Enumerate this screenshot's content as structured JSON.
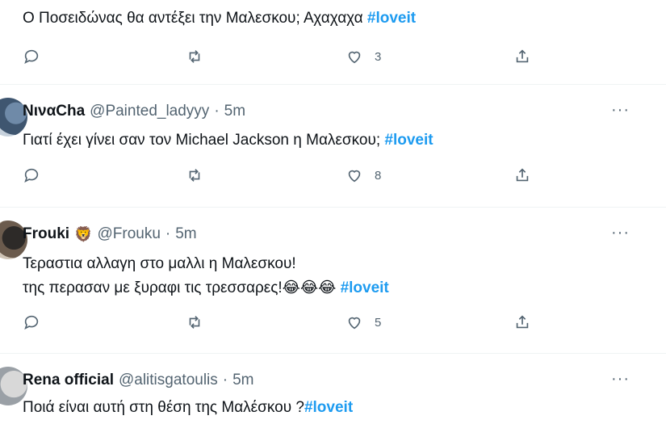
{
  "tweets": [
    {
      "text_pre": "Ο Ποσειδώνας θα αντέξει την Μαλεσκου; Αχαχαχα ",
      "hashtag": "#loveit",
      "likes": "3"
    },
    {
      "name": "ΝιναCha",
      "handle": "@Painted_ladyyy",
      "dot": "·",
      "time": "5m",
      "more": "···",
      "text_pre": "Γιατί έχει γίνει σαν τον Michael Jackson η Μαλεσκου; ",
      "hashtag": "#loveit",
      "likes": "8"
    },
    {
      "name": "Frouki",
      "badge": "🦁",
      "handle": "@Frouku",
      "dot": "·",
      "time": "5m",
      "more": "···",
      "line1": "Τεραστια αλλαγη στο μαλλι η Μαλεσκου!",
      "line2_pre": "της περασαν με ξυραφι τις τρεσσαρες!😂😂😂 ",
      "hashtag": "#loveit",
      "likes": "5"
    },
    {
      "name": "Rena official",
      "handle": "@alitisgatoulis",
      "dot": "·",
      "time": "5m",
      "more": "···",
      "text_pre": "Ποιά είναι αυτή στη θέση της Μαλέσκου ?",
      "hashtag": "#loveit"
    }
  ]
}
